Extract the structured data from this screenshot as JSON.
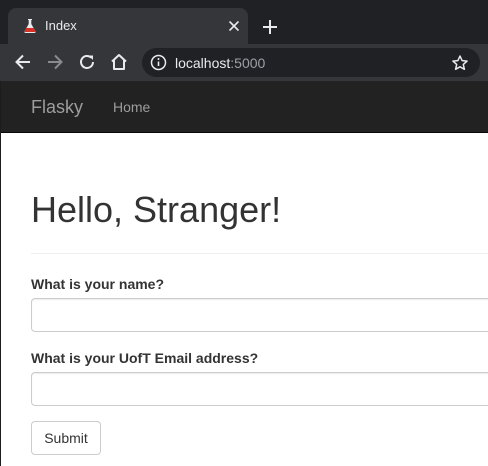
{
  "browser": {
    "tab_title": "Index",
    "tab_favicon": "flask-icon",
    "address_host": "localhost",
    "address_port": ":5000"
  },
  "navbar": {
    "brand": "Flasky",
    "home_link": "Home",
    "background": "#222222"
  },
  "main": {
    "heading": "Hello, Stranger!",
    "form": {
      "name_label": "What is your name?",
      "name_value": "",
      "email_label": "What is your UofT Email address?",
      "email_value": "",
      "submit_label": "Submit"
    }
  }
}
